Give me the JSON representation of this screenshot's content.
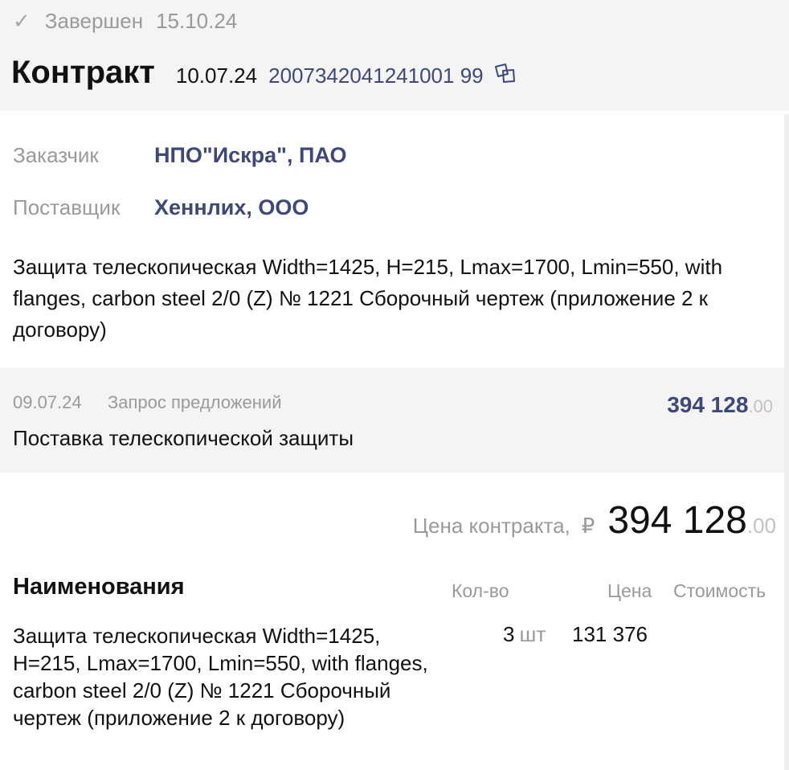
{
  "status": {
    "icon": "check-icon",
    "label": "Завершен",
    "date": "15.10.24"
  },
  "contract": {
    "title": "Контракт",
    "date": "10.07.24",
    "number": "2007342041241001 99",
    "copy_icon": "copy-icon"
  },
  "parties": {
    "customer_label": "Заказчик",
    "customer_value": "НПО\"Искра\", ПАО",
    "supplier_label": "Поставщик",
    "supplier_value": "Хеннлих, ООО"
  },
  "description": "Защита телескопическая Width=1425, H=215, Lmax=1700, Lmin=550, with flanges, carbon steel 2/0 (Z) № 1221 Сборочный чертеж (приложение 2 к договору)",
  "procurement": {
    "date": "09.07.24",
    "type": "Запрос предложений",
    "amount": "394 128",
    "amount_cents": ".00",
    "title": "Поставка телескопической защиты"
  },
  "contract_price": {
    "label": "Цена контракта,",
    "currency": "₽",
    "value": "394 128",
    "cents": ".00"
  },
  "items": {
    "heading": "Наименования",
    "columns": {
      "qty": "Кол-во",
      "price": "Цена",
      "cost": "Стоимость"
    },
    "rows": [
      {
        "name": "Защита телескопическая Width=1425, H=215, Lmax=1700, Lmin=550, with flanges, carbon steel 2/0 (Z) № 1221 Сборочный чертеж (приложение 2 к договору)",
        "qty": "3",
        "unit": "шт",
        "price": "131 376"
      }
    ]
  },
  "colors": {
    "accent": "#3f4878",
    "muted": "#9a9a9a",
    "panel": "#f4f4f4"
  }
}
